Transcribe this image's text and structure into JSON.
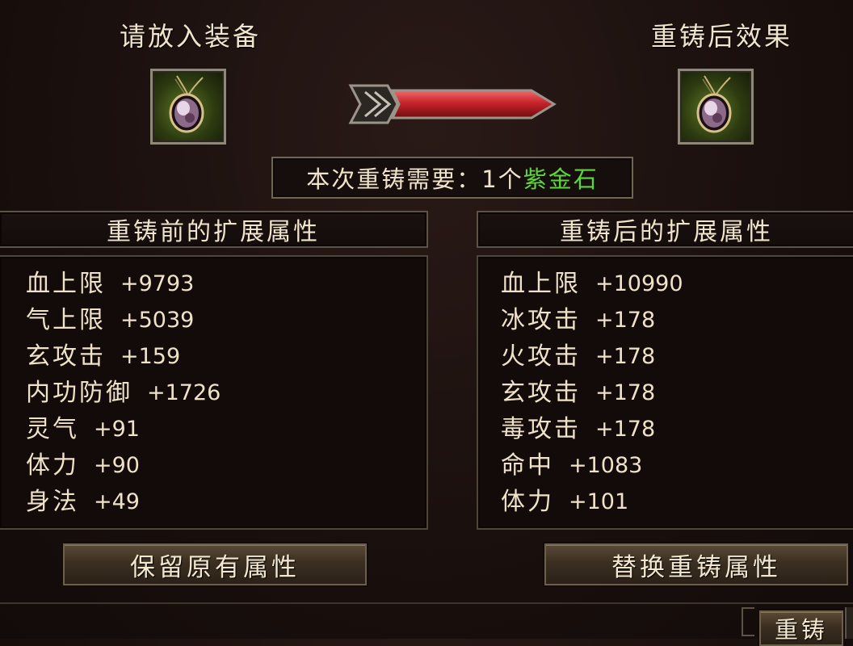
{
  "input_slot": {
    "title": "请放入装备"
  },
  "output_slot": {
    "title": "重铸后效果"
  },
  "cost": {
    "prefix": "本次重铸需要：",
    "quantity": "1个",
    "item": "紫金石"
  },
  "before_panel": {
    "header": "重铸前的扩展属性",
    "attributes": [
      {
        "name": "血上限",
        "value": "+9793"
      },
      {
        "name": "气上限",
        "value": "+5039"
      },
      {
        "name": "玄攻击",
        "value": "+159"
      },
      {
        "name": "内功防御",
        "value": "+1726"
      },
      {
        "name": "灵气",
        "value": "+91"
      },
      {
        "name": "体力",
        "value": "+90"
      },
      {
        "name": "身法",
        "value": "+49"
      }
    ]
  },
  "after_panel": {
    "header": "重铸后的扩展属性",
    "attributes": [
      {
        "name": "血上限",
        "value": "+10990"
      },
      {
        "name": "冰攻击",
        "value": "+178"
      },
      {
        "name": "火攻击",
        "value": "+178"
      },
      {
        "name": "玄攻击",
        "value": "+178"
      },
      {
        "name": "毒攻击",
        "value": "+178"
      },
      {
        "name": "命中",
        "value": "+1083"
      },
      {
        "name": "体力",
        "value": "+101"
      }
    ]
  },
  "buttons": {
    "keep": "保留原有属性",
    "replace": "替换重铸属性",
    "reforge": "重铸"
  },
  "colors": {
    "highlight_green": "#5ed43f",
    "arrow_red": "#c8242a"
  }
}
